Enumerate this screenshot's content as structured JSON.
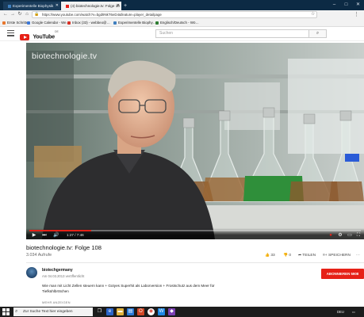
{
  "browser": {
    "tabs": [
      {
        "label": "Experimentelle Biophysik",
        "active": false,
        "color": "#3f7fbf"
      },
      {
        "label": "(4) biotechnologie.tv: Folge 10",
        "active": true,
        "color": "#e62117"
      }
    ],
    "new_tab_symbol": "+",
    "window_controls": [
      "–",
      "□",
      "✕"
    ],
    "nav": {
      "back": "←",
      "forward": "→",
      "reload": "↻",
      "home": "⌂"
    },
    "url": "https://www.youtube.com/watch?v=bgd9NkT6eD4&feature=player_detailpage",
    "bookmarks": [
      {
        "label": "Erste Schritte",
        "color": "#e8772e"
      },
      {
        "label": "Google Calendar - We…",
        "color": "#3c78d8"
      },
      {
        "label": "Inbox (33) - webbeo@…",
        "color": "#d93025"
      },
      {
        "label": "Experimentelle Biophy…",
        "color": "#3f7fbf"
      },
      {
        "label": "Englisch/Deutsch - Wö…",
        "color": "#2e7d32"
      }
    ]
  },
  "youtube": {
    "logo_text": "YouTube",
    "logo_region": "DE",
    "search_placeholder": "Suchen",
    "search_icon": "search-icon",
    "brand_color": "#e62117"
  },
  "player": {
    "watermark": "biotechnologie.tv",
    "time": "1:27 / 7:46",
    "progress_fraction": 0.187,
    "controls": {
      "play": "▶",
      "next": "⏭",
      "volume": "🔊",
      "settings": "⚙",
      "fullscreen": "⛶"
    }
  },
  "video": {
    "title": "biotechnologie.tv: Folge 108",
    "views": "3.034 Aufrufe",
    "likes": "33",
    "dislikes": "0",
    "share_label": "TEILEN",
    "save_label": "SPEICHERN",
    "more_symbol": "···"
  },
  "channel": {
    "name": "biotechgermany",
    "date": "Am 04.03.2013 veröffentlicht",
    "subscribe_label": "ABONNIEREN 5908",
    "description": "Wie man mit Licht Zellen steuern kann + Gotyes Superhit als Laborversion + Frostschutz aus dem Meer für Tiefkühlbrötchen",
    "show_more": "MEHR ANZEIGEN"
  },
  "taskbar": {
    "search_placeholder": "Zur Suche Text hier eingeben",
    "tray_text": "DEU"
  }
}
